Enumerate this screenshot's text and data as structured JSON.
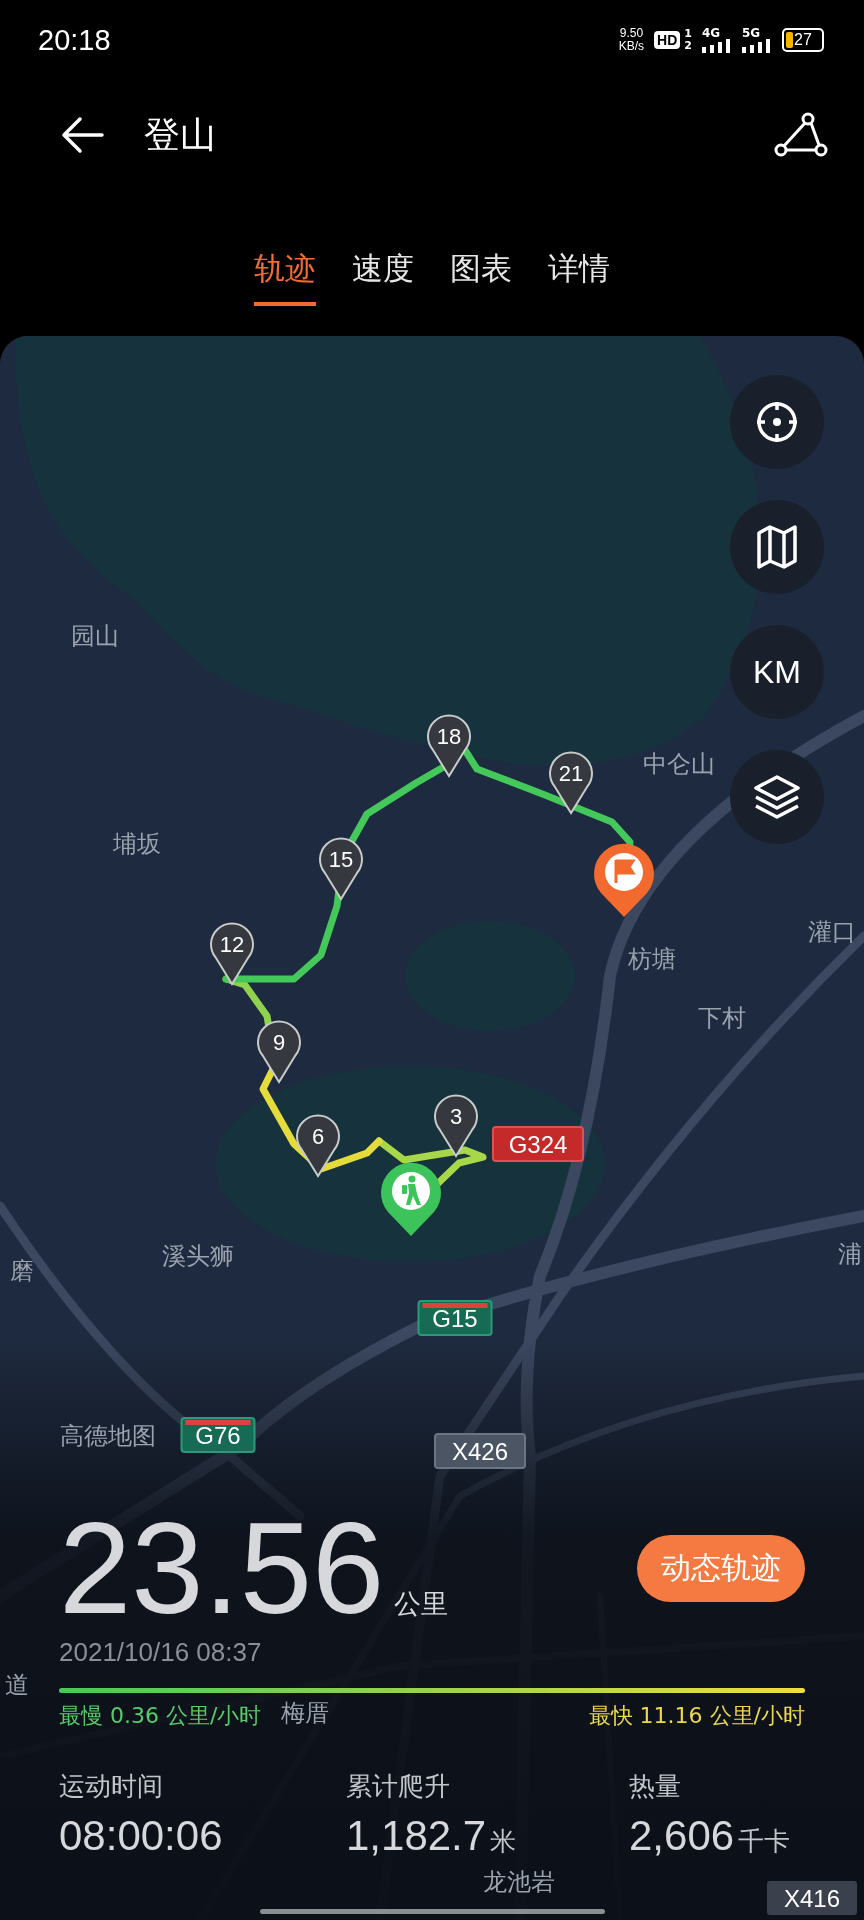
{
  "status_bar": {
    "time": "20:18",
    "net_speed": "9.50",
    "net_speed_unit": "KB/s",
    "hd_badge": "HD",
    "sim_slots": [
      "1",
      "2"
    ],
    "networks": [
      "4G",
      "5G"
    ],
    "battery": "27"
  },
  "header": {
    "title": "登山"
  },
  "tabs": [
    {
      "label": "轨迹",
      "selected": true
    },
    {
      "label": "速度",
      "selected": false
    },
    {
      "label": "图表",
      "selected": false
    },
    {
      "label": "详情",
      "selected": false
    }
  ],
  "map": {
    "place_labels": [
      "园山",
      "埔坂",
      "中仑山",
      "枋塘",
      "下村",
      "灌口",
      "溪头狮",
      "磨",
      "浦",
      "高德地图",
      "梅厝",
      "道",
      "龙池岩"
    ],
    "road_shields": [
      {
        "text": "G324",
        "kind": "national"
      },
      {
        "text": "G15",
        "kind": "expressway"
      },
      {
        "text": "G76",
        "kind": "expressway"
      },
      {
        "text": "X426",
        "kind": "county"
      },
      {
        "text": "X416",
        "kind": "county"
      }
    ],
    "km_markers": [
      "18",
      "21",
      "15",
      "12",
      "9",
      "6",
      "3"
    ],
    "controls": [
      {
        "kind": "locate"
      },
      {
        "kind": "map"
      },
      {
        "kind": "units",
        "text": "KM"
      },
      {
        "kind": "layers"
      }
    ]
  },
  "summary": {
    "distance": "23.56",
    "distance_unit": "公里",
    "replay_button": "动态轨迹",
    "datetime": "2021/10/16 08:37",
    "slowest": "最慢 0.36 公里/小时",
    "fastest": "最快 11.16 公里/小时"
  },
  "stats": [
    {
      "label": "运动时间",
      "value": "08:00:06"
    },
    {
      "label": "累计爬升",
      "value": "1,182.7",
      "unit": "米"
    },
    {
      "label": "热量",
      "value": "2,606",
      "unit": "千卡"
    }
  ]
}
